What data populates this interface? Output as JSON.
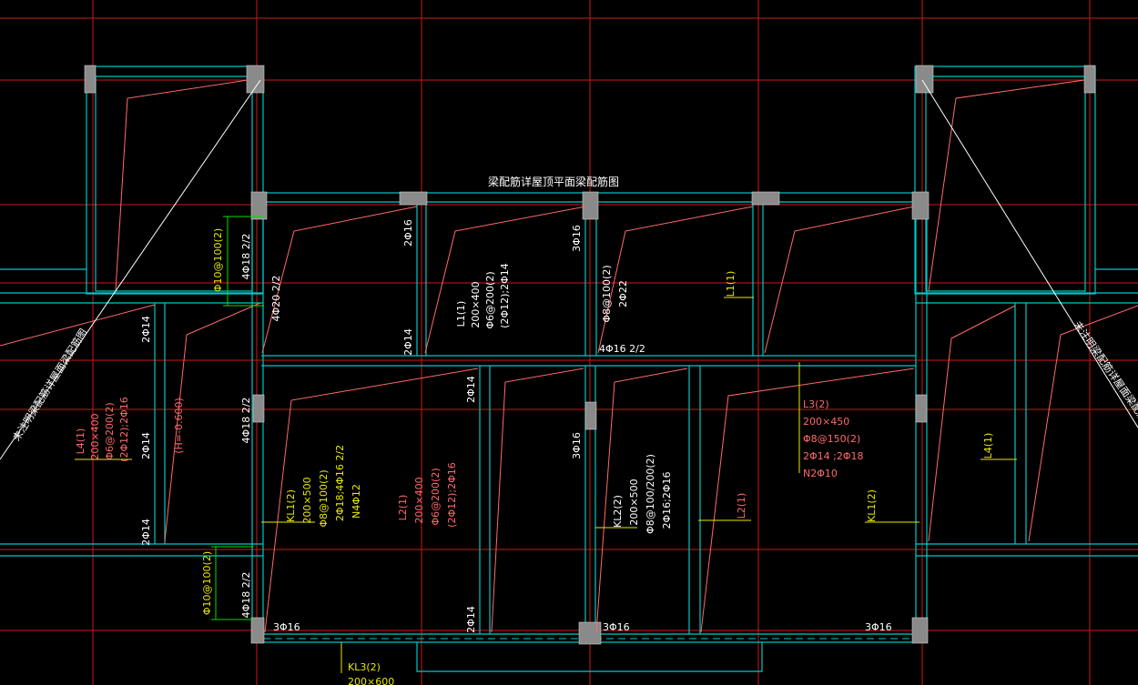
{
  "drawing_title": "梁配筋详屋顶平面梁配筋图",
  "side_note_left": "未注明梁配筋详屋面梁配筋图",
  "side_note_right": "未注明梁配筋详屋面梁配筋图",
  "colors": {
    "background": "#000000",
    "axis_grid": "#d01818",
    "wall": "#00c8c8",
    "column": "#8a8a8a",
    "beam_text_yellow": "#e8e800",
    "beam_text_red": "#ff6a6a",
    "dim_green": "#00e000",
    "leader_white": "#ffffff"
  },
  "labels": {
    "a1": "2Φ16",
    "a2": "3Φ16",
    "a3": "2Φ14",
    "a4": "4Φ16  2/2",
    "a5": "2Φ14",
    "a6": "2Φ14",
    "a7": "3Φ16",
    "a8": "2Φ14",
    "a9": "3Φ16",
    "a10": "3Φ16",
    "a11": "3Φ16",
    "a12": "2Φ14",
    "a13": "4Φ18  2/2",
    "a14": "4Φ20  2/2",
    "a15": "4Φ18  2/2",
    "a16": "4Φ18  2/2",
    "a17": "Φ10@100(2)",
    "a18": "Φ10@100(2)",
    "a19": "(H=-0.600)",
    "a20": "2Φ14",
    "a21": "L1(1)",
    "a22": "L4(1)"
  },
  "beams": {
    "L1": [
      "L1(1)",
      "200×400",
      "Φ6@200(2)",
      "(2Φ12);2Φ14"
    ],
    "L1b": [
      "Φ8@100(2)",
      "2Φ22"
    ],
    "L4": [
      "L4(1)",
      "200×400",
      "Φ6@200(2)",
      "(2Φ12);2Φ16"
    ],
    "KL1": [
      "KL1(2)",
      "200×500",
      "Φ8@100(2)",
      "2Φ18;4Φ16  2/2",
      "N4Φ12"
    ],
    "L2": [
      "L2(1)",
      "200×400",
      "Φ6@200(2)",
      "(2Φ12);2Φ16"
    ],
    "KL2": [
      "KL2(2)",
      "200×500",
      "Φ8@100/200(2)",
      "2Φ16;2Φ16"
    ],
    "L3": [
      "L3(2)",
      "200×450",
      "Φ8@150(2)",
      "2Φ14 ;2Φ18",
      "N2Φ10"
    ],
    "L2b": [
      "L2(1)"
    ],
    "KL1b": [
      "KL1(2)"
    ],
    "KL3": [
      "KL3(2)",
      "200×600"
    ]
  }
}
